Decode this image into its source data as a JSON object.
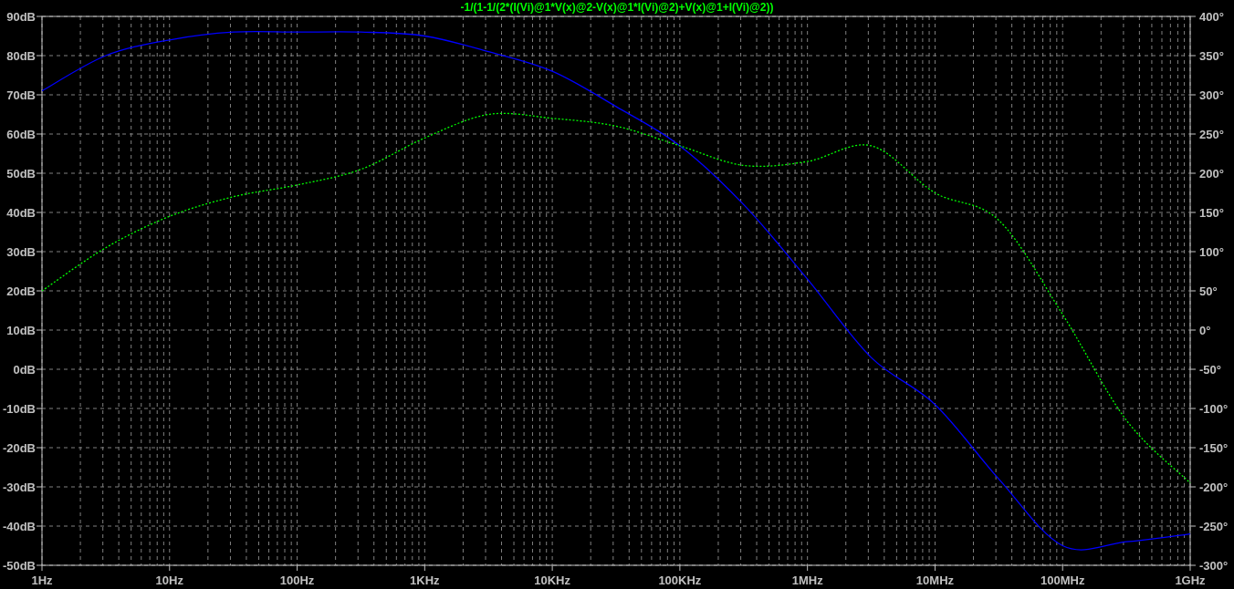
{
  "plot": {
    "chart_data": {
      "type": "line",
      "title": "-1/(1-1/(2*(I(Vi)@1*V(x)@2-V(x)@1*I(Vi)@2)+V(x)@1+I(Vi)@2))",
      "categories": [
        "1Hz",
        null,
        "10Hz",
        null,
        "100Hz",
        null,
        "1KHz",
        null,
        "10KHz",
        null,
        "100KHz",
        null,
        "1MHz",
        null,
        "10MHz",
        null,
        "100MHz",
        null,
        "1GHz"
      ],
      "ylim": [
        -50,
        90
      ],
      "yticks": [
        {
          "value": 90,
          "label": "90dB"
        },
        {
          "value": 80,
          "label": "80dB"
        },
        {
          "value": 70,
          "label": "70dB"
        },
        {
          "value": 60,
          "label": "60dB"
        },
        {
          "value": 50,
          "label": "50dB"
        },
        {
          "value": 40,
          "label": "40dB"
        },
        {
          "value": 30,
          "label": "30dB"
        },
        {
          "value": 20,
          "label": "20dB"
        },
        {
          "value": 10,
          "label": "10dB"
        },
        {
          "value": 0,
          "label": "0dB"
        },
        {
          "value": -10,
          "label": "-10dB"
        },
        {
          "value": -20,
          "label": "-20dB"
        },
        {
          "value": -30,
          "label": "-30dB"
        },
        {
          "value": -40,
          "label": "-40dB"
        },
        {
          "value": -50,
          "label": "-50dB"
        }
      ],
      "y2lim": [
        -300,
        400
      ],
      "y2ticks": [
        {
          "value": 400,
          "label": "400°"
        },
        {
          "value": 350,
          "label": "350°"
        },
        {
          "value": 300,
          "label": "300°"
        },
        {
          "value": 250,
          "label": "250°"
        },
        {
          "value": 200,
          "label": "200°"
        },
        {
          "value": 150,
          "label": "150°"
        },
        {
          "value": 100,
          "label": "100°"
        },
        {
          "value": 50,
          "label": "50°"
        },
        {
          "value": 0,
          "label": "0°"
        },
        {
          "value": -50,
          "label": "-50°"
        },
        {
          "value": -100,
          "label": "-100°"
        },
        {
          "value": -150,
          "label": "-150°"
        },
        {
          "value": -200,
          "label": "-200°"
        },
        {
          "value": -250,
          "label": "-250°"
        },
        {
          "value": -300,
          "label": "-300°"
        }
      ],
      "series": [
        {
          "color": "#0000ff",
          "values": [
            71,
            80,
            84,
            86,
            86,
            86,
            85,
            81,
            76,
            67,
            57,
            42,
            23,
            3,
            -9,
            -28,
            -45,
            -44,
            -42
          ]
        },
        {
          "color": "#00ff00",
          "axis": "y2",
          "line_style": "dotted",
          "values": [
            50,
            105,
            145,
            170,
            185,
            205,
            245,
            275,
            270,
            260,
            235,
            210,
            215,
            235,
            175,
            140,
            20,
            -115,
            -195
          ]
        }
      ],
      "grid": true
    }
  }
}
